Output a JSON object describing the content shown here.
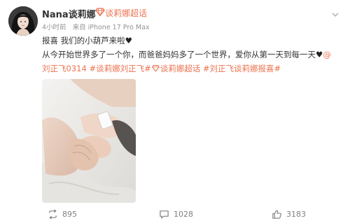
{
  "post": {
    "username": "Nana谈莉娜",
    "supertopic": "谈莉娜超话",
    "time": "4小时前",
    "source": "来自 iPhone 17 Pro Max",
    "text": {
      "line1": "报喜  我们的小葫芦来啦",
      "line1_heart": "♥",
      "line2": "从今开始世界多了一个你，而爸爸妈妈多了一个世界，爱你从第一天到每一天",
      "line2_heart": "♥",
      "mention": "@",
      "mention_name": "刘正飞0314",
      "topic1": "#谈莉娜刘正飞#",
      "topic2": "谈莉娜超话",
      "topic3": "#刘正飞谈莉娜报喜#"
    }
  },
  "actions": {
    "repost_count": "895",
    "comment_count": "1028",
    "like_count": "3183"
  },
  "colors": {
    "accent": "#eb7350",
    "text": "#333333",
    "meta": "#939393"
  },
  "icons": {
    "badge": "supertopic-diamond-icon",
    "repost": "repost-icon",
    "comment": "comment-icon",
    "like": "thumbs-up-icon",
    "more": "chevron-down-icon"
  }
}
